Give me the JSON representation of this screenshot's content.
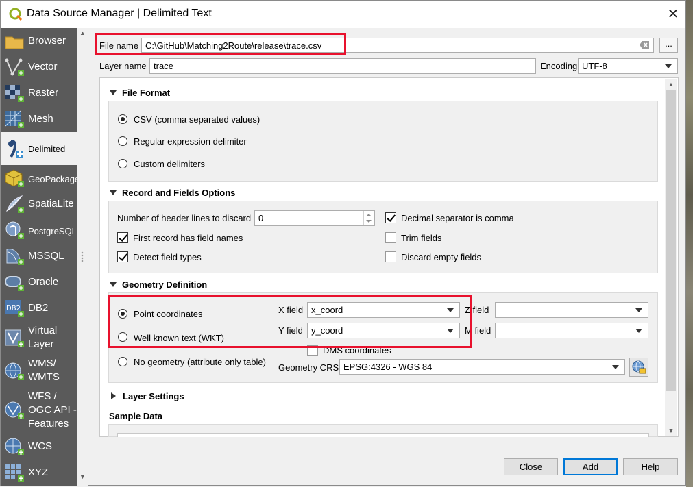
{
  "window": {
    "title": "Data Source Manager | Delimited Text",
    "close_symbol": "✕"
  },
  "sidebar": {
    "items": [
      {
        "label": "Browser",
        "icon": "folder-icon"
      },
      {
        "label": "Vector",
        "icon": "vector-icon"
      },
      {
        "label": "Raster",
        "icon": "raster-icon"
      },
      {
        "label": "Mesh",
        "icon": "mesh-icon"
      },
      {
        "label": "Delimited",
        "icon": "delimited-text-icon"
      },
      {
        "label": "GeoPackage",
        "icon": "geopackage-icon"
      },
      {
        "label": "SpatiaLite",
        "icon": "spatialite-icon"
      },
      {
        "label": "PostgreSQL",
        "icon": "postgresql-icon"
      },
      {
        "label": "MSSQL",
        "icon": "mssql-icon"
      },
      {
        "label": "Oracle",
        "icon": "oracle-icon"
      },
      {
        "label": "DB2",
        "icon": "db2-icon"
      },
      {
        "label": "Virtual\nLayer",
        "icon": "virtual-layer-icon"
      },
      {
        "label": "WMS/\nWMTS",
        "icon": "wms-icon"
      },
      {
        "label": "WFS /\nOGC API -\nFeatures",
        "icon": "wfs-icon"
      },
      {
        "label": "WCS",
        "icon": "wcs-icon"
      },
      {
        "label": "XYZ",
        "icon": "xyz-icon"
      }
    ],
    "active": "Delimited"
  },
  "file": {
    "label": "File name",
    "value": "C:\\GitHub\\Matching2Route\\release\\trace.csv",
    "browse_label": "..."
  },
  "layer": {
    "label": "Layer name",
    "value": "trace",
    "encoding_label": "Encoding",
    "encoding_value": "UTF-8"
  },
  "file_format": {
    "heading": "File Format",
    "options": [
      "CSV (comma separated values)",
      "Regular expression delimiter",
      "Custom delimiters"
    ],
    "selected": "CSV (comma separated values)"
  },
  "record_options": {
    "heading": "Record and Fields Options",
    "header_lines_label": "Number of header lines to discard",
    "header_lines_value": "0",
    "decimal_comma": {
      "label": "Decimal separator is comma",
      "checked": true
    },
    "first_record": {
      "label": "First record has field names",
      "checked": true
    },
    "trim_fields": {
      "label": "Trim fields",
      "checked": false
    },
    "detect_types": {
      "label": "Detect field types",
      "checked": true
    },
    "discard_empty": {
      "label": "Discard empty fields",
      "checked": false
    }
  },
  "geometry": {
    "heading": "Geometry Definition",
    "point_label": "Point coordinates",
    "wkt_label": "Well known text (WKT)",
    "none_label": "No geometry (attribute only table)",
    "selected": "Point coordinates",
    "x_label": "X field",
    "x_value": "x_coord",
    "y_label": "Y field",
    "y_value": "y_coord",
    "z_label": "Z field",
    "z_value": "",
    "m_label": "M field",
    "m_value": "",
    "dms_label": "DMS coordinates",
    "dms_checked": false,
    "crs_label": "Geometry CRS",
    "crs_value": "EPSG:4326 - WGS 84"
  },
  "layer_settings": {
    "heading": "Layer Settings"
  },
  "sample_data": {
    "heading": "Sample Data"
  },
  "buttons": {
    "close": "Close",
    "add": "Add",
    "help": "Help"
  },
  "colors": {
    "highlight": "#e8112d",
    "sidebar_bg": "#5a5a5a",
    "default_button_border": "#0078d7"
  }
}
